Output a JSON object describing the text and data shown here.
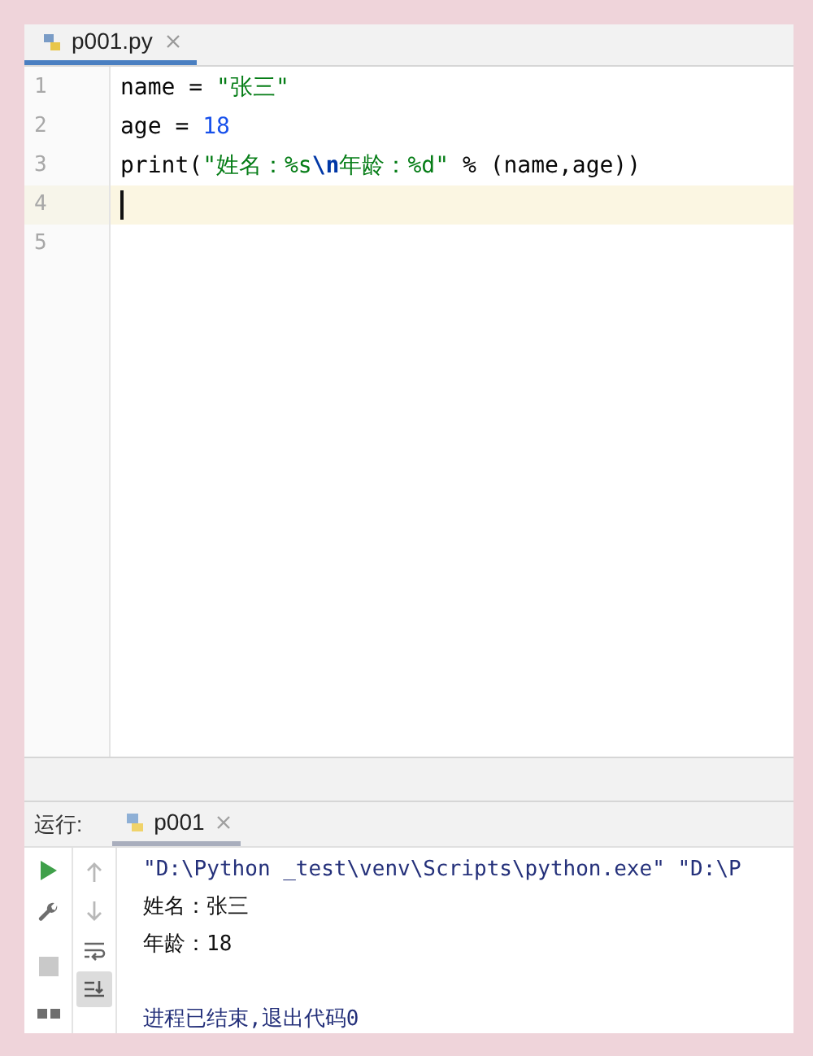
{
  "editor": {
    "tabs": [
      {
        "label": "p001.py",
        "selected": true
      }
    ],
    "lines": [
      {
        "number": "1",
        "current": false,
        "tokens": [
          {
            "kind": "plain",
            "text": "name = "
          },
          {
            "kind": "string",
            "text": "\"张三\""
          }
        ]
      },
      {
        "number": "2",
        "current": false,
        "tokens": [
          {
            "kind": "plain",
            "text": "age = "
          },
          {
            "kind": "number",
            "text": "18"
          }
        ]
      },
      {
        "number": "3",
        "current": false,
        "tokens": [
          {
            "kind": "plain",
            "text": "print("
          },
          {
            "kind": "string",
            "text": "\"姓名：%s"
          },
          {
            "kind": "escape",
            "text": "\\n"
          },
          {
            "kind": "string",
            "text": "年龄：%d\""
          },
          {
            "kind": "plain",
            "text": " % (name,age))"
          }
        ]
      },
      {
        "number": "4",
        "current": true
      },
      {
        "number": "5",
        "current": false
      }
    ]
  },
  "run_panel": {
    "label": "运行:",
    "tabs": [
      {
        "label": "p001",
        "selected": true
      }
    ],
    "tools": [
      {
        "kind": "up",
        "selected": false
      },
      {
        "kind": "down",
        "selected": false
      },
      {
        "kind": "wrap",
        "selected": false
      },
      {
        "kind": "scroll",
        "selected": true
      }
    ],
    "console": [
      {
        "kind": "command",
        "text": "\"D:\\Python _test\\venv\\Scripts\\python.exe\" \"D:\\P"
      },
      {
        "kind": "output",
        "text": "姓名：张三"
      },
      {
        "kind": "output",
        "text": "年龄：18"
      },
      {
        "kind": "exit",
        "text": "进程已结束,退出代码0"
      }
    ]
  }
}
